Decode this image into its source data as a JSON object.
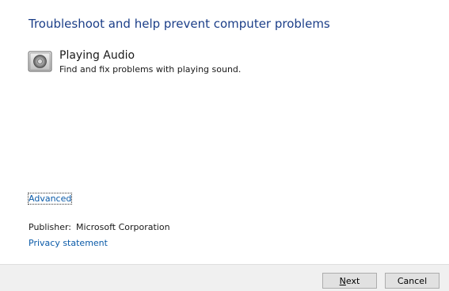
{
  "header": {
    "title": "Troubleshoot and help prevent computer problems"
  },
  "task": {
    "icon": "speaker-icon",
    "name": "Playing Audio",
    "description": "Find and fix problems with playing sound."
  },
  "links": {
    "advanced": "Advanced",
    "privacy": "Privacy statement"
  },
  "publisher": {
    "label": "Publisher:",
    "value": "Microsoft Corporation"
  },
  "footer": {
    "next_accel": "N",
    "next_rest": "ext",
    "cancel": "Cancel"
  },
  "colors": {
    "title": "#1b3e88",
    "link": "#0a5aa8",
    "footer_bg": "#f0f0f0",
    "button_bg": "#e1e1e1"
  }
}
